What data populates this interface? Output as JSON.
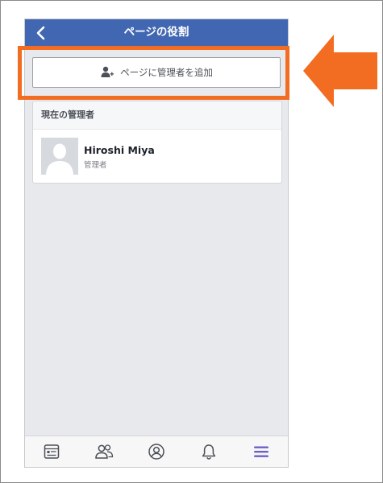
{
  "header": {
    "title": "ページの役割"
  },
  "add_admin_button": {
    "label": "ページに管理者を追加"
  },
  "admins_section": {
    "title": "現在の管理者",
    "admins": [
      {
        "name": "Hiroshi Miya",
        "role": "管理者"
      }
    ]
  },
  "tab_bar": {
    "tabs": [
      {
        "icon": "news-feed-icon",
        "active": false
      },
      {
        "icon": "friends-icon",
        "active": false
      },
      {
        "icon": "profile-icon",
        "active": false
      },
      {
        "icon": "notifications-bell-icon",
        "active": false
      },
      {
        "icon": "menu-icon",
        "active": true
      }
    ]
  },
  "colors": {
    "header_blue": "#4267b2",
    "highlight_orange": "#f26d21",
    "active_tab": "#6b5fc8",
    "background": "#e8e9ec"
  }
}
